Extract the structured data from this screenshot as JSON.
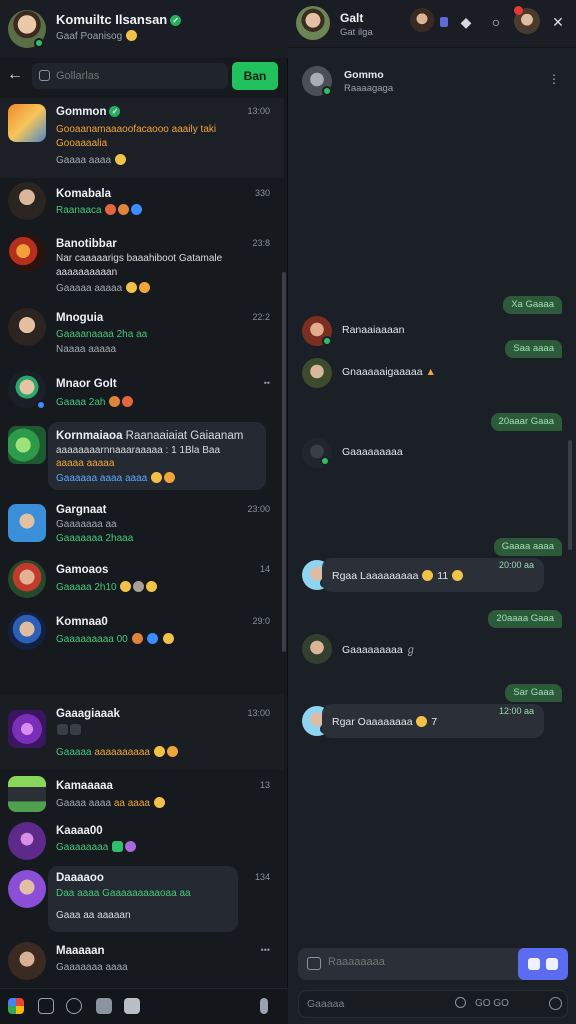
{
  "left_header": {
    "name": "Komuiltc Ilsansan",
    "status": "Gaaf Poanisog"
  },
  "search": {
    "placeholder": "Gollarlas",
    "button_label": "Ban"
  },
  "chats": [
    {
      "title": "Gommon",
      "time": "13:00",
      "lines": [
        "Gooaanamaaaoofacaooo aaaily taki",
        "Gooaaaalia",
        "Gaaaa aaaa"
      ]
    },
    {
      "title": "Komabala",
      "time": "330",
      "lines": [
        "Raanaaca"
      ]
    },
    {
      "title": "Banotibbar",
      "time": "23:8",
      "lines": [
        "Nar caaaaarigs baaahiboot Gatamale",
        "aaaaaaaaaan",
        "Gaaaaa aaaaa"
      ]
    },
    {
      "title": "Mnoguia",
      "time": "22:2",
      "lines": [
        "Gaaaanaaaa 2ha aa",
        "Naaaa aaaaa"
      ]
    },
    {
      "title": "Mnaor GoIt",
      "time": "",
      "lines": [
        "Gaaaa 2ah"
      ]
    },
    {
      "title": "Kornmaiaoa",
      "time": "",
      "subtitle": "Raanaaiaiat Gaiaanam",
      "lines": [
        "aaaaaaaarnnaaaraaaaa : 1 1Bla Baa",
        "aaaaa aaaaa",
        "Gaaaaaa aaaa aaaa"
      ]
    },
    {
      "title": "Gargnaat",
      "time": "23:00",
      "lines": [
        "Gaaaaaaa aa",
        "Gaaaaaaa 2haaa"
      ]
    },
    {
      "title": "Gamoaos",
      "time": "14",
      "lines": [
        "Gaaaaa 2h10"
      ]
    },
    {
      "title": "Komnaa0",
      "time": "29:0",
      "lines": [
        "Gaaaaaaaaa 00"
      ]
    },
    {
      "title": "Gaaagiaaak",
      "time": "13:00",
      "lines": [
        "Gaaaaa"
      ]
    },
    {
      "title": "Kamaaaaa",
      "time": "13",
      "lines": [
        "Gaaaa aaaa"
      ]
    },
    {
      "title": "Kaaaa00",
      "time": "",
      "lines": [
        "Gaaaaaaaa"
      ]
    },
    {
      "title": "Daaaaoo",
      "time": "134",
      "lines": [
        "Daa aaaa Gaaaaaaaaaoaa aa",
        "Gaaa aa aaaaan"
      ]
    },
    {
      "title": "Maaaaan",
      "time": "",
      "lines": [
        "Gaaaaaaa aaaa"
      ]
    }
  ],
  "right_header": {
    "name": "Galt",
    "status": "Gat ilga"
  },
  "contact": {
    "name": "Gommo",
    "status": "Raaaagaga"
  },
  "messages": [
    {
      "dir": "out",
      "text": "Xa Gaaaa"
    },
    {
      "dir": "in",
      "text": "Ranaaiaaaan"
    },
    {
      "dir": "out",
      "text": "Saa aaaa"
    },
    {
      "dir": "in",
      "text": "Gnaaaaaigaaaaa"
    },
    {
      "dir": "out",
      "text": "20aaar Gaaa"
    },
    {
      "dir": "in",
      "text": "Gaaaaaaaaa"
    },
    {
      "dir": "out",
      "text": "Gaaaa aaaa"
    },
    {
      "dir": "in-bubble",
      "text": "Rgaa Laaaaaaaaa",
      "meta": "20:00 aa"
    },
    {
      "dir": "out",
      "text": "20aaaa Gaaa"
    },
    {
      "dir": "in",
      "text": "Gaaaaaaaaa"
    },
    {
      "dir": "out",
      "text": "Sar Gaaa"
    },
    {
      "dir": "in-bubble",
      "text": "Rgar Oaaaaaaaa",
      "meta": "12:00 aa"
    }
  ],
  "composer": {
    "placeholder": "Raaaaaaaa"
  },
  "bottom_search": {
    "label": "Gaaaaa",
    "meta": "GO GO"
  },
  "colors": {
    "accent_green": "#21c15d",
    "send_button": "#5b6cf0",
    "bubble_out": "#2d5a3a",
    "bubble_in": "#2a2f38"
  }
}
